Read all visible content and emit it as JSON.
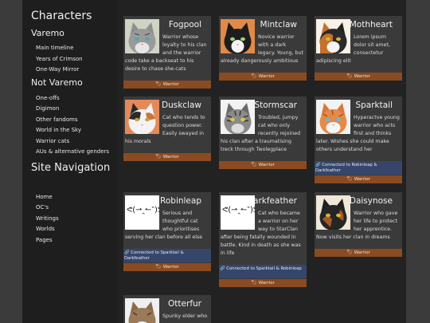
{
  "sidebar": {
    "heading": "Characters",
    "group1": "Varemo",
    "varemo_links": [
      "Main timeline",
      "Years of Crimson",
      "One-Way Mirror"
    ],
    "group2": "Not Varemo",
    "not_varemo_links": [
      "One-offs",
      "Digimon",
      "Other fandoms",
      "World in the Sky",
      "Warrior cats",
      "AUs & alternative genders"
    ],
    "nav_heading": "Site Navigation",
    "nav_links": [
      "Home",
      "OC's",
      "Writings",
      "Worlds",
      "Pages"
    ]
  },
  "cards": [
    {
      "name": "Fogpool",
      "desc": "Warrior whose loyalty to his clan and the warrior code take a backseat to his desire to chase she-cats",
      "tag": "Warrior",
      "icon": "cat-portrait-gray"
    },
    {
      "name": "Mintclaw",
      "desc": "Novice warrior with a dark legacy. Young, but already dangerously ambitious",
      "tag": "Warrior",
      "icon": "cat-portrait-tuxedo"
    },
    {
      "name": "Mothheart",
      "desc": "Lorem ipsum dolor sit amet, consectetur adipiscing elit",
      "tag": "Warrior",
      "icon": "cat-portrait-calico"
    },
    {
      "name": "Duskclaw",
      "desc": "Cat who tends to question power. Easily swayed in his morals",
      "tag": "Warrior",
      "icon": "cat-portrait-calico-white"
    },
    {
      "name": "Stormscar",
      "desc": "Troubled, jumpy cat who only recently rejoined his clan after a traumatising treck through Twolegplace",
      "tag": "Warrior",
      "icon": "cat-portrait-tabby"
    },
    {
      "name": "Sparktail",
      "desc": "Hyperactve young warrior who acts first and thinks later. Wishes she could make others understand her",
      "connection": "Connected to Robinleap & Darkfeather",
      "tag": "Warrior",
      "icon": "cat-portrait-orange"
    },
    {
      "name": "Robinleap",
      "desc": "Serious and thoughtful cat who prioritises serving her clan before all else",
      "connection": "Connected to Sparktail & Darkfeather",
      "tag": "Warrior",
      "icon": "kaomoji-placeholder",
      "kaomoji": "ᕙ(⇀‸↼‶)ᕗ"
    },
    {
      "name": "Darkfeather",
      "desc": "Cat who became a warrior on her way to StarClan after being fatally wounded in battle. Kind in death as she was in life",
      "connection": "Connected to Sparktail & Robinleap",
      "tag": "Warrior",
      "icon": "kaomoji-placeholder",
      "kaomoji": "ᕙ(⇀‸↼‶)ᕗ"
    },
    {
      "name": "Daisynose",
      "desc": "Warrior who gave her life to protect her apprentice. Now visits her clan in dreams",
      "tag": "Warrior",
      "icon": "cat-portrait-dark-tortie"
    },
    {
      "name": "Otterfur",
      "desc": "Spunky elder who",
      "icon": "cat-portrait-tabby-white"
    }
  ],
  "colors": {
    "tag_bg": "#8a4a22",
    "connection_bg": "#36466a",
    "card_bg": "#3a3a3a",
    "main_bg": "#222222",
    "sidebar_bg": "#1e1e1e"
  }
}
